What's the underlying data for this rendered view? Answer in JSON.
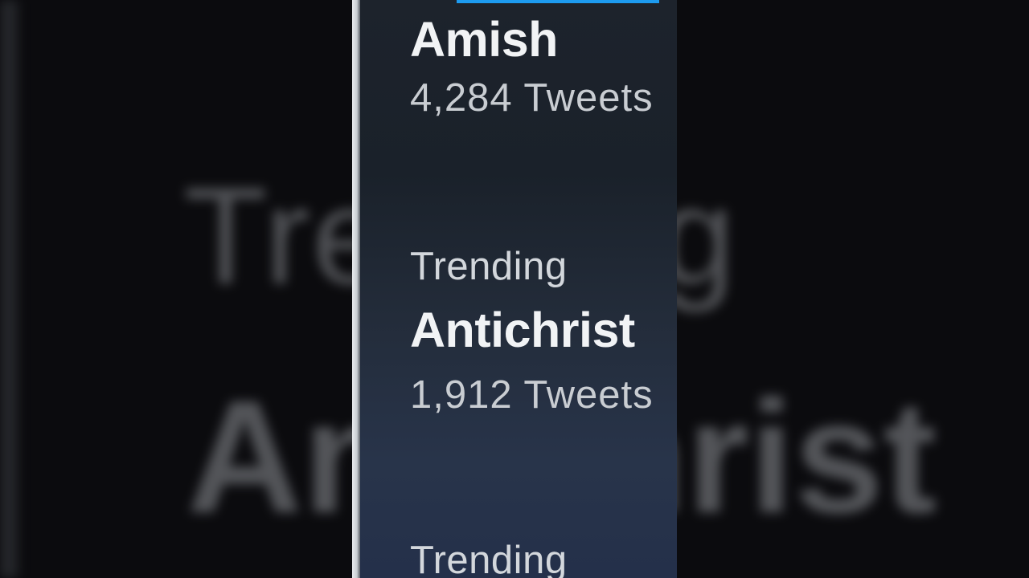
{
  "background": {
    "blurred_label": "Trending",
    "blurred_topic": "Antichrist"
  },
  "trends": [
    {
      "label": "",
      "topic": "Amish",
      "count": "4,284 Tweets"
    },
    {
      "label": "Trending",
      "topic": "Antichrist",
      "count": "1,912 Tweets"
    },
    {
      "label": "Trending",
      "topic": "",
      "count": ""
    }
  ],
  "colors": {
    "accent": "#1d9bf0",
    "panel_bg": "#1d232c",
    "topic_text": "#f1f3f5",
    "meta_text": "#c9cdd2"
  }
}
